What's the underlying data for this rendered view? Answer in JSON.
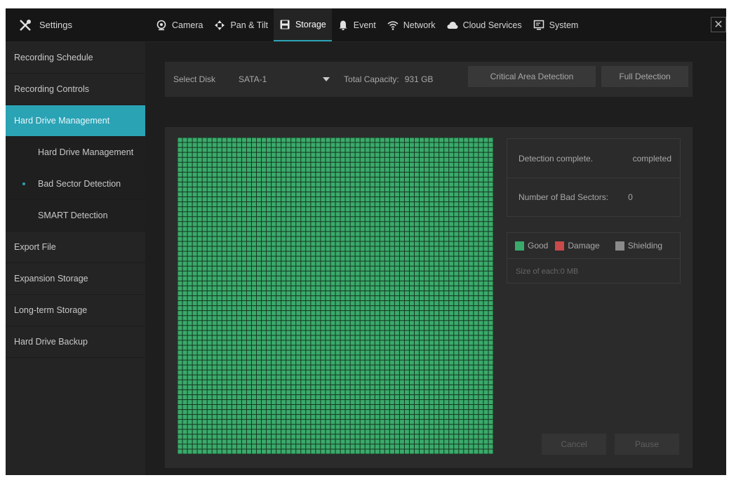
{
  "header": {
    "settings_label": "Settings",
    "tabs": [
      {
        "label": "Camera",
        "icon": "camera-icon"
      },
      {
        "label": "Pan & Tilt",
        "icon": "pan-tilt-icon"
      },
      {
        "label": "Storage",
        "icon": "storage-icon",
        "active": true
      },
      {
        "label": "Event",
        "icon": "event-icon"
      },
      {
        "label": "Network",
        "icon": "wifi-icon"
      },
      {
        "label": "Cloud Services",
        "icon": "cloud-icon"
      },
      {
        "label": "System",
        "icon": "monitor-icon"
      }
    ],
    "close_icon": "close-icon"
  },
  "sidebar": {
    "items": [
      {
        "label": "Recording Schedule"
      },
      {
        "label": "Recording Controls"
      },
      {
        "label": "Hard Drive Management",
        "active": true
      },
      {
        "label": "Hard Drive Management",
        "sub": true
      },
      {
        "label": "Bad Sector Detection",
        "sub": true,
        "selected": true
      },
      {
        "label": "SMART Detection",
        "sub": true
      },
      {
        "label": "Export File"
      },
      {
        "label": "Expansion Storage"
      },
      {
        "label": "Long-term Storage"
      },
      {
        "label": "Hard Drive Backup"
      }
    ]
  },
  "toolbar": {
    "select_disk_label": "Select Disk",
    "disk_value": "SATA-1",
    "total_capacity_label": "Total Capacity:",
    "total_capacity_value": "931 GB",
    "critical_button": "Critical Area Detection",
    "full_button": "Full Detection"
  },
  "status": {
    "detection_label": "Detection complete.",
    "detection_value": "completed",
    "bad_sectors_label": "Number of Bad Sectors:",
    "bad_sectors_value": "0"
  },
  "legend": {
    "good": "Good",
    "damage": "Damage",
    "shielding": "Shielding",
    "size_text": "Size of each:0 MB"
  },
  "actions": {
    "cancel": "Cancel",
    "pause": "Pause"
  },
  "colors": {
    "accent": "#2aa3b5",
    "good": "#3aaa6b",
    "damage": "#c84a4a",
    "shielding": "#8a8a8a"
  }
}
